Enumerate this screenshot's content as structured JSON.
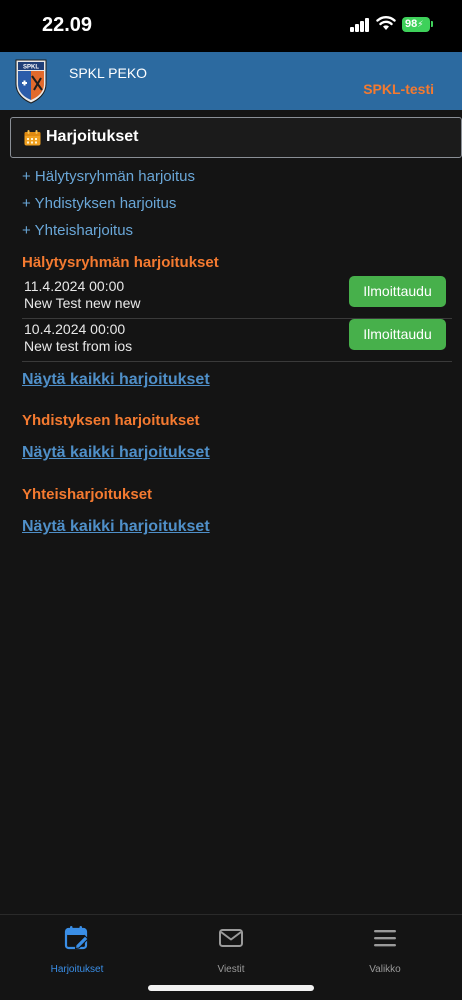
{
  "status_bar": {
    "time": "22.09",
    "battery": "98"
  },
  "header": {
    "org_name": "SPKL PEKO",
    "environment": "SPKL-testi",
    "logo_text": "SPKL"
  },
  "section": {
    "title": "Harjoitukset",
    "icon": "calendar-icon"
  },
  "add_links": [
    "+ Hälytysryhmän harjoitus",
    "+ Yhdistyksen harjoitus",
    "+ Yhteisharjoitus"
  ],
  "groups": [
    {
      "title": "Hälytysryhmän harjoitukset",
      "events": [
        {
          "date": "11.4.2024 00:00",
          "name": "New Test new new",
          "button": "Ilmoittaudu"
        },
        {
          "date": "10.4.2024 00:00",
          "name": "New test from ios",
          "button": "Ilmoittaudu"
        }
      ],
      "show_all": "Näytä kaikki harjoitukset"
    },
    {
      "title": "Yhdistyksen harjoitukset",
      "events": [],
      "show_all": "Näytä kaikki harjoitukset"
    },
    {
      "title": "Yhteisharjoitukset",
      "events": [],
      "show_all": "Näytä kaikki harjoitukset"
    }
  ],
  "tabs": [
    {
      "label": "Harjoitukset",
      "icon": "calendar-edit-icon",
      "active": true
    },
    {
      "label": "Viestit",
      "icon": "envelope-icon",
      "active": false
    },
    {
      "label": "Valikko",
      "icon": "hamburger-menu-icon",
      "active": false
    }
  ],
  "colors": {
    "accent_orange": "#f47a30",
    "header_blue": "#2c6aa0",
    "link_blue": "#6aa7d8",
    "button_green": "#47b04b",
    "active_tab": "#3a8ee6",
    "background": "#141414"
  }
}
